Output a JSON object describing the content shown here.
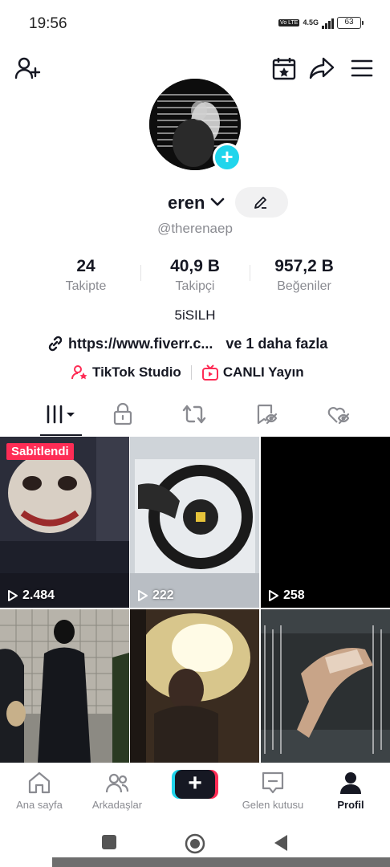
{
  "status_bar": {
    "time": "19:56",
    "network": "4.5G",
    "volte": "Vo LTE",
    "battery": "63"
  },
  "header": {
    "add_user_icon": "person-add-icon",
    "calendar_icon": "calendar-star-icon",
    "share_icon": "share-arrow-icon",
    "menu_icon": "hamburger-menu-icon"
  },
  "profile": {
    "name": "eren",
    "handle": "@therenaep",
    "bio": "5iSILH",
    "link": "https://www.fiverr.c...",
    "link_more": "ve 1 daha fazla",
    "studio_label": "TikTok Studio",
    "live_label": "CANLI Yayın"
  },
  "stats": [
    {
      "value": "24",
      "label": "Takipte"
    },
    {
      "value": "40,9 B",
      "label": "Takipçi"
    },
    {
      "value": "957,2 B",
      "label": "Beğeniler"
    }
  ],
  "tabs": [
    {
      "icon": "videos-grid-icon"
    },
    {
      "icon": "lock-icon"
    },
    {
      "icon": "repost-icon"
    },
    {
      "icon": "favorites-hidden-icon"
    },
    {
      "icon": "liked-hidden-icon"
    }
  ],
  "videos": [
    {
      "views": "2.484",
      "pinned_label": "Sabitlendi",
      "colors": [
        "#2d2f3d",
        "#c9b7a8"
      ]
    },
    {
      "views": "222",
      "colors": [
        "#d9dde2",
        "#1b1b1b"
      ]
    },
    {
      "views": "258",
      "colors": [
        "#000000",
        "#0a0a0a"
      ]
    },
    {
      "colors": [
        "#b9b6ad",
        "#14161c"
      ]
    },
    {
      "colors": [
        "#2b2018",
        "#f6e7a8"
      ]
    },
    {
      "colors": [
        "#2a2e30",
        "#c9a88a"
      ]
    }
  ],
  "bottom_nav": [
    {
      "label": "Ana sayfa",
      "icon": "home-icon"
    },
    {
      "label": "Arkadaşlar",
      "icon": "friends-icon"
    },
    {
      "label": "",
      "icon": "plus-icon"
    },
    {
      "label": "Gelen kutusu",
      "icon": "inbox-icon"
    },
    {
      "label": "Profil",
      "icon": "profile-icon"
    }
  ],
  "colors": {
    "accent_pink": "#fe2c55",
    "accent_cyan": "#20d5ec",
    "text": "#161823",
    "muted": "#8a8b91"
  }
}
